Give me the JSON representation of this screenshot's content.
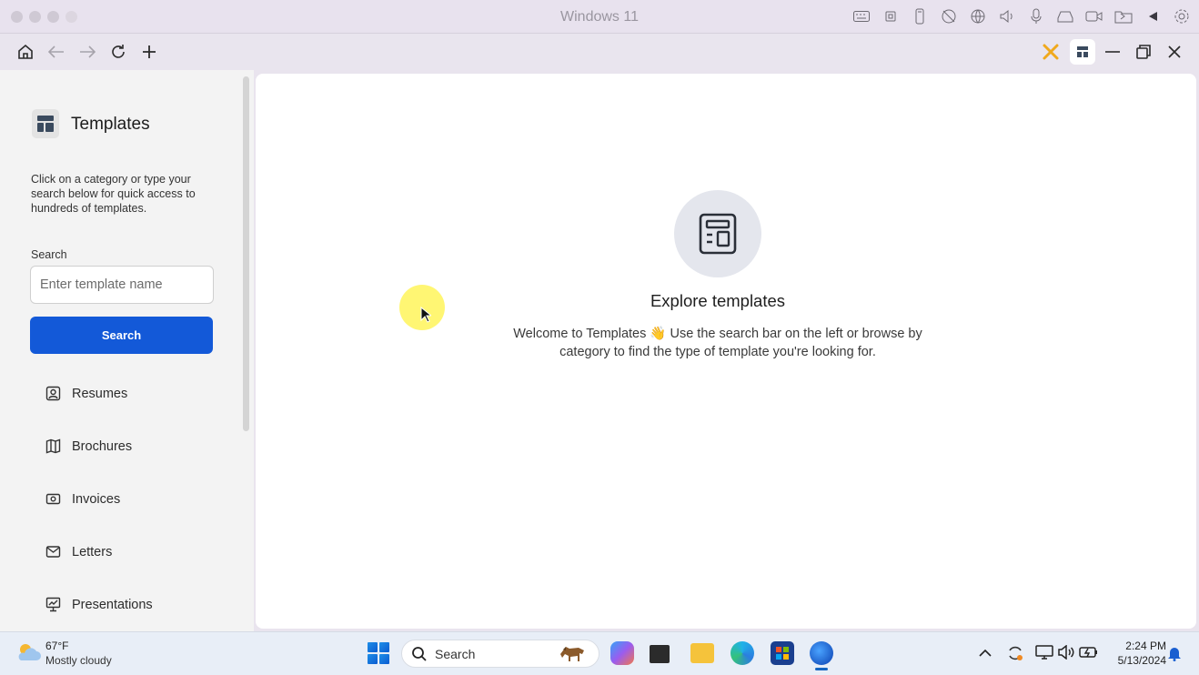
{
  "window": {
    "title": "Windows 11"
  },
  "mac_status_icons": [
    "keyboard-icon",
    "cpu-icon",
    "usb-icon",
    "camera-off-icon",
    "globe-icon",
    "speaker-icon",
    "microphone-icon",
    "disk-icon",
    "video-icon",
    "folder-share-icon",
    "arrow-left-icon",
    "gear-icon"
  ],
  "toolbar": {
    "home": "home-icon",
    "back": "back-arrow-icon",
    "forward": "forward-arrow-icon",
    "reload": "reload-icon",
    "new_tab": "plus-icon"
  },
  "sidebar": {
    "title": "Templates",
    "description": "Click on a category or type your search below for quick access to hundreds of templates.",
    "search_label": "Search",
    "search_placeholder": "Enter template name",
    "search_button": "Search",
    "categories": [
      {
        "label": "Resumes",
        "icon": "resume-icon"
      },
      {
        "label": "Brochures",
        "icon": "brochure-icon"
      },
      {
        "label": "Invoices",
        "icon": "invoice-icon"
      },
      {
        "label": "Letters",
        "icon": "letter-icon"
      },
      {
        "label": "Presentations",
        "icon": "presentation-icon"
      }
    ]
  },
  "main": {
    "title": "Explore templates",
    "welcome": "Welcome to Templates 👋 Use the search bar on the left or browse by category to find the type of template you're looking for."
  },
  "taskbar": {
    "weather_temp": "67°F",
    "weather_desc": "Mostly cloudy",
    "search_label": "Search",
    "time": "2:24 PM",
    "date": "5/13/2024"
  },
  "colors": {
    "accent": "#1359d8",
    "sidebar_bg": "#f3f3f3",
    "cursor_highlight": "#fff45a"
  }
}
